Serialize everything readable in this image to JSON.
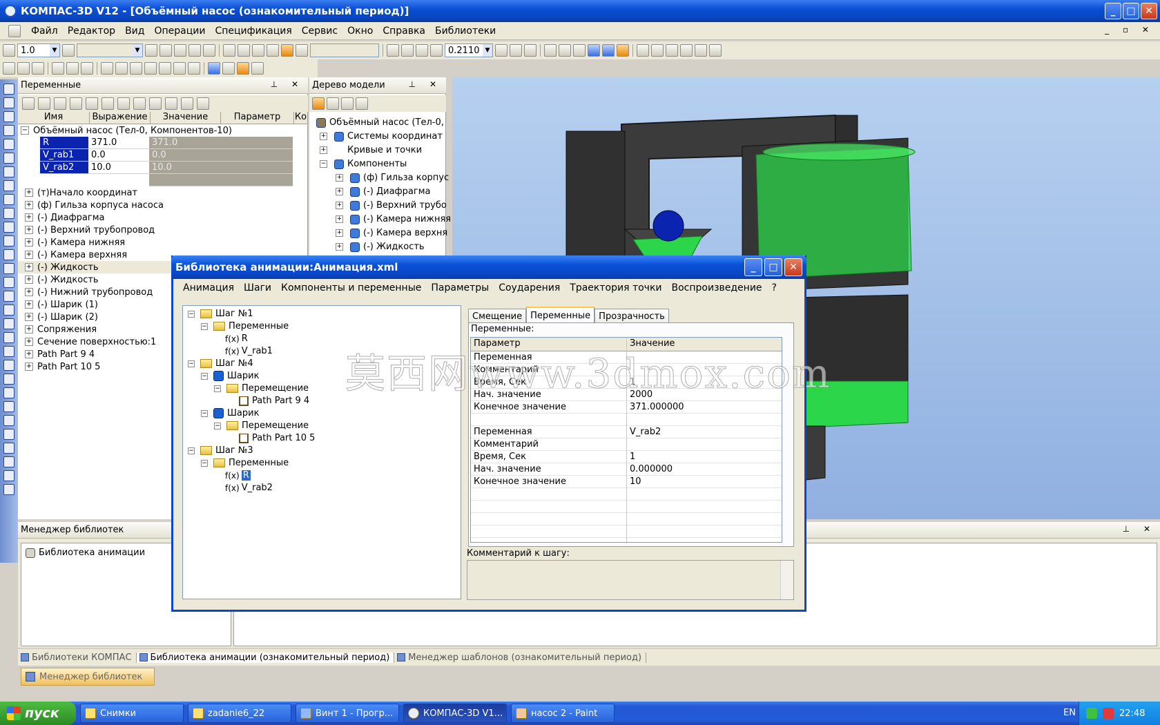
{
  "window": {
    "title": "КОМПАС-3D V12 - [Объёмный насос (ознакомительный период)]",
    "minimize": "_",
    "maximize": "□",
    "close": "✕"
  },
  "menu": [
    "Файл",
    "Редактор",
    "Вид",
    "Операции",
    "Спецификация",
    "Сервис",
    "Окно",
    "Справка",
    "Библиотеки"
  ],
  "toolbar": {
    "step_value": "1.0",
    "zoom_value": "0.2110"
  },
  "variables_panel": {
    "title": "Переменные",
    "columns": [
      "Имя",
      "Выражение",
      "Значение",
      "Параметр",
      "Ко"
    ],
    "root": "Объёмный насос (Тел-0, Компонентов-10)",
    "vars": [
      {
        "name": "R",
        "expr": "371.0",
        "value": "371.0"
      },
      {
        "name": "V_rab1",
        "expr": "0.0",
        "value": "0.0"
      },
      {
        "name": "V_rab2",
        "expr": "10.0",
        "value": "10.0"
      }
    ],
    "items": [
      "(т)Начало координат",
      "(ф) Гильза корпуса насоса",
      "(-) Диафрагма",
      "(-) Верхний трубопровод",
      "(-) Камера нижняя",
      "(-) Камера верхняя",
      "(-) Жидкость",
      "(-) Жидкость",
      "(-) Нижний трубопровод",
      "(-) Шарик (1)",
      "(-) Шарик (2)",
      "Сопряжения",
      "Сечение поверхностью:1",
      "Path Part 9 4",
      "Path Part 10 5"
    ]
  },
  "model_tree": {
    "title": "Дерево модели",
    "root": "Объёмный насос (Тел-0,",
    "items": [
      "Системы координат",
      "Кривые и точки",
      "Компоненты",
      "(ф) Гильза корпус",
      "(-) Диафрагма",
      "(-) Верхний трубо",
      "(-) Камера нижняя",
      "(-) Камера верхня",
      "(-) Жидкость"
    ]
  },
  "library_manager": {
    "title": "Менеджер библиотек",
    "item": "Библиотека анимации",
    "tabs": [
      "Библиотеки КОМПАС",
      "Библиотека анимации (ознакомительный период)",
      "Менеджер шаблонов (ознакомительный период)"
    ],
    "bottom_button": "Менеджер библиотек"
  },
  "dialog": {
    "title": "Библиотека анимации:Анимация.xml",
    "menu": [
      "Анимация",
      "Шаги",
      "Компоненты и переменные",
      "Параметры",
      "Соударения",
      "Траектория точки",
      "Воспроизведение",
      "?"
    ],
    "tree": {
      "step1": "Шаг №1",
      "step1_vars": "Переменные",
      "step1_v1": "R",
      "step1_v2": "V_rab1",
      "step4": "Шаг №4",
      "ball": "Шарик",
      "move": "Перемещение",
      "path1": "Path Part 9 4",
      "path2": "Path Part 10 5",
      "step3": "Шаг №3",
      "step3_vars": "Переменные",
      "step3_v1": "R",
      "step3_v2": "V_rab2",
      "fx": "f(x)"
    },
    "tabs": [
      "Смещение",
      "Переменные",
      "Прозрачность"
    ],
    "tab_label": "Переменные:",
    "grid_header": {
      "param": "Параметр",
      "value": "Значение"
    },
    "grid_rows": [
      {
        "k": "Переменная",
        "v": ""
      },
      {
        "k": "Комментарий",
        "v": ""
      },
      {
        "k": "Время, Сек",
        "v": "1"
      },
      {
        "k": "Нач. значение",
        "v": "2000"
      },
      {
        "k": "Конечное значение",
        "v": "371.000000"
      },
      {
        "k": "",
        "v": ""
      },
      {
        "k": "Переменная",
        "v": "V_rab2"
      },
      {
        "k": "Комментарий",
        "v": ""
      },
      {
        "k": "Время, Сек",
        "v": "1"
      },
      {
        "k": "Нач. значение",
        "v": "0.000000"
      },
      {
        "k": "Конечное значение",
        "v": "10"
      }
    ],
    "comment_label": "Комментарий к шагу:"
  },
  "watermark": "莫西网www.3dmox.com",
  "taskbar": {
    "start": "пуск",
    "tasks": [
      "Снимки",
      "zadanie6_22",
      "Винт 1 - Прогр...",
      "КОМПАС-3D V1...",
      "насос 2 - Paint"
    ],
    "lang": "EN",
    "clock": "22:48"
  },
  "colors": {
    "titlebar": "#0a4fd6",
    "selection": "#0a24b0",
    "fluid_green": "#2cd64a",
    "body_dark": "#3b3b3b"
  }
}
